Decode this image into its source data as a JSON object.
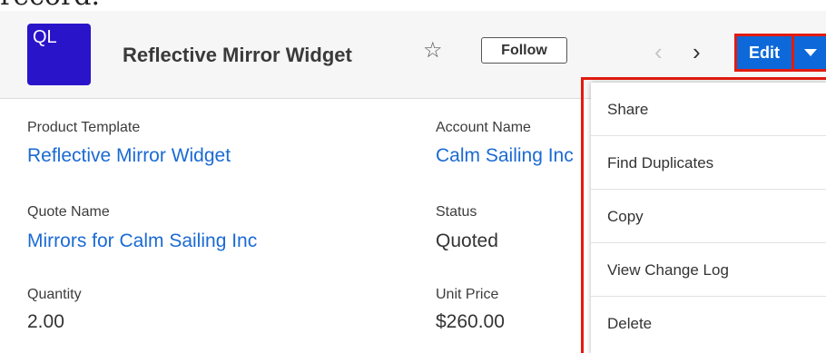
{
  "intro_text": "record.",
  "header": {
    "avatar_text": "QL",
    "title": "Reflective Mirror Widget",
    "follow_label": "Follow",
    "edit_label": "Edit",
    "icons": {
      "favorite": "star-outline-icon",
      "previous": "chevron-left-icon",
      "next": "chevron-right-icon",
      "actions": "caret-down-icon"
    }
  },
  "fields": {
    "product_template": {
      "label": "Product Template",
      "value": "Reflective Mirror Widget"
    },
    "account_name": {
      "label": "Account Name",
      "value": "Calm Sailing Inc"
    },
    "quote_name": {
      "label": "Quote Name",
      "value": "Mirrors for Calm Sailing Inc"
    },
    "status": {
      "label": "Status",
      "value": "Quoted"
    },
    "quantity": {
      "label": "Quantity",
      "value": "2.00"
    },
    "unit_price": {
      "label": "Unit Price",
      "value": "$260.00"
    }
  },
  "menu": {
    "items": [
      "Share",
      "Find Duplicates",
      "Copy",
      "View Change Log",
      "Delete"
    ]
  },
  "colors": {
    "avatar": "#2a14c9",
    "primary_button": "#0d69d9",
    "highlight": "#e11b0f",
    "link": "#1b6ad3"
  }
}
